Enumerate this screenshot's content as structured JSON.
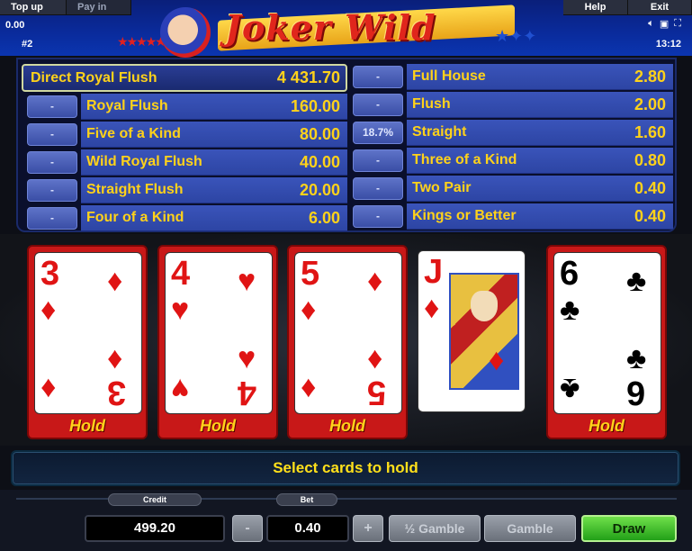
{
  "topbar": {
    "tab_topup": "Top up",
    "tab_payin": "Pay in",
    "tab_help": "Help",
    "tab_exit": "Exit",
    "credit_display": "0.00",
    "session_id": "#2",
    "clock": "13:12",
    "icons": [
      "speaker-icon",
      "screen-icon",
      "fullscreen-icon"
    ]
  },
  "logo": {
    "text": "Joker Wild"
  },
  "paytable": {
    "top": {
      "name": "Direct Royal Flush",
      "value": "4 431.70"
    },
    "left": [
      {
        "btn": "-",
        "name": "Royal Flush",
        "value": "160.00"
      },
      {
        "btn": "-",
        "name": "Five of a Kind",
        "value": "80.00"
      },
      {
        "btn": "-",
        "name": "Wild Royal Flush",
        "value": "40.00"
      },
      {
        "btn": "-",
        "name": "Straight Flush",
        "value": "20.00"
      },
      {
        "btn": "-",
        "name": "Four of a Kind",
        "value": "6.00"
      }
    ],
    "right": [
      {
        "btn": "-",
        "name": "Full House",
        "value": "2.80"
      },
      {
        "btn": "-",
        "name": "Flush",
        "value": "2.00"
      },
      {
        "btn": "18.7%",
        "name": "Straight",
        "value": "1.60"
      },
      {
        "btn": "-",
        "name": "Three of a Kind",
        "value": "0.80"
      },
      {
        "btn": "-",
        "name": "Two Pair",
        "value": "0.40"
      },
      {
        "btn": "-",
        "name": "Kings or Better",
        "value": "0.40"
      }
    ]
  },
  "cards": [
    {
      "rank": "3",
      "suit": "♦",
      "color": "red",
      "held": true,
      "hold_label": "Hold"
    },
    {
      "rank": "4",
      "suit": "♥",
      "color": "red",
      "held": true,
      "hold_label": "Hold"
    },
    {
      "rank": "5",
      "suit": "♦",
      "color": "red",
      "held": true,
      "hold_label": "Hold"
    },
    {
      "rank": "J",
      "suit": "♦",
      "color": "red",
      "held": false,
      "hold_label": ""
    },
    {
      "rank": "6",
      "suit": "♣",
      "color": "black",
      "held": true,
      "hold_label": "Hold"
    }
  ],
  "message": "Select cards to hold",
  "controls": {
    "credit_label": "Credit",
    "credit_value": "499.20",
    "bet_label": "Bet",
    "bet_value": "0.40",
    "minus": "-",
    "plus": "+",
    "half_gamble": "½ Gamble",
    "gamble": "Gamble",
    "draw": "Draw"
  },
  "colors": {
    "paytable_text": "#ffd21a",
    "hold_frame": "#c81818",
    "draw_button": "#22a018"
  }
}
